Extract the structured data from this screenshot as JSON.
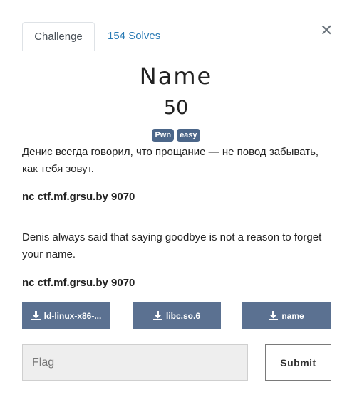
{
  "tabs": [
    {
      "label": "Challenge"
    },
    {
      "label": "154 Solves"
    }
  ],
  "close_icon": "close-icon",
  "challenge": {
    "name": "Name",
    "points": "50",
    "tags": [
      "Pwn",
      "easy"
    ],
    "description_ru": "Денис всегда говорил, что прощание — не повод забывать, как тебя зовут.",
    "command_ru": "nc ctf.mf.grsu.by 9070",
    "description_en": "Denis always said that saying goodbye is not a reason to forget your name.",
    "command_en": "nc ctf.mf.grsu.by 9070"
  },
  "files": [
    {
      "label": "ld-linux-x86-...",
      "icon": "download-icon"
    },
    {
      "label": "libc.so.6",
      "icon": "download-icon"
    },
    {
      "label": "name",
      "icon": "download-icon"
    }
  ],
  "form": {
    "flag_placeholder": "Flag",
    "flag_value": "",
    "submit_label": "Submit"
  },
  "colors": {
    "tag_bg": "#4b6689",
    "file_button_bg": "#5b7191",
    "tab_link": "#2a7bb5"
  }
}
